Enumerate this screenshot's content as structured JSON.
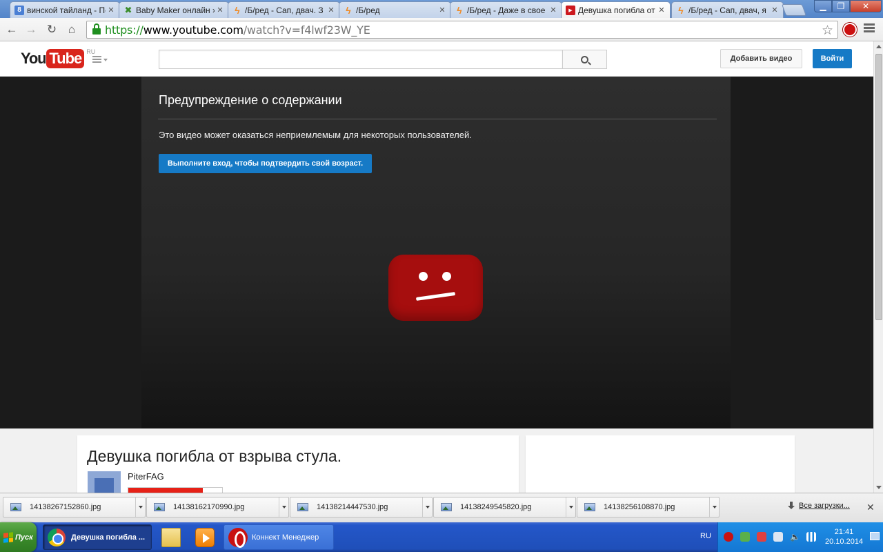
{
  "browser": {
    "tabs": [
      {
        "label": "винской тайланд - Пс",
        "favicon": "google-icon",
        "active": false
      },
      {
        "label": "Baby Maker онлайн »",
        "favicon": "puzzle-icon",
        "active": false
      },
      {
        "label": "/Б/ред - Cап, двач. З",
        "favicon": "lightning-icon",
        "active": false
      },
      {
        "label": "/Б/ред",
        "favicon": "lightning-icon",
        "active": false
      },
      {
        "label": "/Б/ред - Даже в свое",
        "favicon": "lightning-icon",
        "active": false
      },
      {
        "label": "Девушка погибла от",
        "favicon": "youtube-icon",
        "active": true
      },
      {
        "label": "/Б/ред - Cап, двач, я",
        "favicon": "lightning-icon",
        "active": false
      }
    ],
    "address": {
      "scheme": "https://",
      "host": "www.youtube.com",
      "path": "/watch?v=f4lwf23W_YE"
    }
  },
  "youtube": {
    "logo_you": "You",
    "logo_tube": "Tube",
    "region": "RU",
    "search_placeholder": "",
    "upload_label": "Добавить видео",
    "signin_label": "Войти"
  },
  "player": {
    "warning_title": "Предупреждение о содержании",
    "warning_text": "Это видео может оказаться неприемлемым для некоторых пользователей.",
    "confirm_button": "Выполните вход, чтобы подтвердить свой возраст."
  },
  "video": {
    "title": "Девушка погибла от взрыва стула.",
    "owner": "PiterFAG"
  },
  "downloads": {
    "items": [
      "14138267152860.jpg",
      "14138162170990.jpg",
      "14138214447530.jpg",
      "14138249545820.jpg",
      "14138256108870.jpg"
    ],
    "show_all": "Все загрузки..."
  },
  "taskbar": {
    "start_label": "Пуск",
    "tasks": [
      {
        "label": "Девушка погибла ...",
        "active": true
      },
      {
        "label": "Коннект Менеджер",
        "active": false
      }
    ],
    "language": "RU",
    "time": "21:41",
    "date": "20.10.2014"
  },
  "colors": {
    "youtube_red": "#d9251c",
    "signin_blue": "#167ac6",
    "sadface_red": "#a60e0e",
    "xp_blue": "#2457c9"
  }
}
